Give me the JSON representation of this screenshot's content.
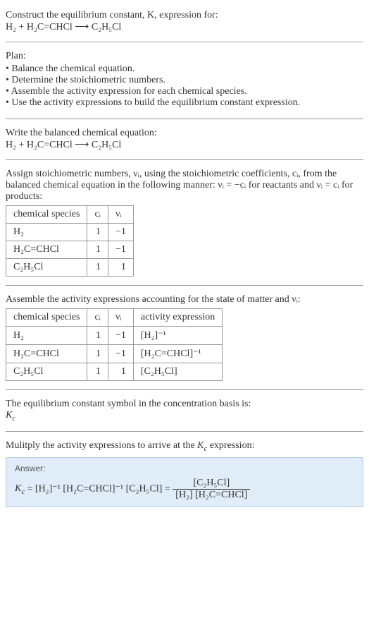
{
  "intro": {
    "line1": "Construct the equilibrium constant, K, expression for:",
    "equation": "H₂ + H₂C=CHCl ⟶ C₂H₅Cl"
  },
  "plan": {
    "heading": "Plan:",
    "items": [
      "Balance the chemical equation.",
      "Determine the stoichiometric numbers.",
      "Assemble the activity expression for each chemical species.",
      "Use the activity expressions to build the equilibrium constant expression."
    ]
  },
  "balanced": {
    "heading": "Write the balanced chemical equation:",
    "equation": "H₂ + H₂C=CHCl ⟶ C₂H₅Cl"
  },
  "stoich": {
    "text": "Assign stoichiometric numbers, νᵢ, using the stoichiometric coefficients, cᵢ, from the balanced chemical equation in the following manner: νᵢ = −cᵢ for reactants and νᵢ = cᵢ for products:",
    "headers": {
      "species": "chemical species",
      "ci": "cᵢ",
      "vi": "νᵢ"
    },
    "rows": [
      {
        "species": "H₂",
        "ci": "1",
        "vi": "−1"
      },
      {
        "species": "H₂C=CHCl",
        "ci": "1",
        "vi": "−1"
      },
      {
        "species": "C₂H₅Cl",
        "ci": "1",
        "vi": "1"
      }
    ]
  },
  "activity": {
    "text": "Assemble the activity expressions accounting for the state of matter and νᵢ:",
    "headers": {
      "species": "chemical species",
      "ci": "cᵢ",
      "vi": "νᵢ",
      "expr": "activity expression"
    },
    "rows": [
      {
        "species": "H₂",
        "ci": "1",
        "vi": "−1",
        "expr": "[H₂]⁻¹"
      },
      {
        "species": "H₂C=CHCl",
        "ci": "1",
        "vi": "−1",
        "expr": "[H₂C=CHCl]⁻¹"
      },
      {
        "species": "C₂H₅Cl",
        "ci": "1",
        "vi": "1",
        "expr": "[C₂H₅Cl]"
      }
    ]
  },
  "symbol": {
    "text": "The equilibrium constant symbol in the concentration basis is:",
    "sym": "K_c"
  },
  "final": {
    "text": "Mulitply the activity expressions to arrive at the K_c expression:",
    "answer_label": "Answer:",
    "kc_eq_left": "K_c = [H₂]⁻¹ [H₂C=CHCl]⁻¹ [C₂H₅Cl] =",
    "frac_num": "[C₂H₅Cl]",
    "frac_den": "[H₂] [H₂C=CHCl]"
  },
  "chart_data": {
    "type": "table",
    "tables": [
      {
        "title": "stoichiometric numbers",
        "columns": [
          "chemical species",
          "cᵢ",
          "νᵢ"
        ],
        "rows": [
          [
            "H₂",
            1,
            -1
          ],
          [
            "H₂C=CHCl",
            1,
            -1
          ],
          [
            "C₂H₅Cl",
            1,
            1
          ]
        ]
      },
      {
        "title": "activity expressions",
        "columns": [
          "chemical species",
          "cᵢ",
          "νᵢ",
          "activity expression"
        ],
        "rows": [
          [
            "H₂",
            1,
            -1,
            "[H₂]⁻¹"
          ],
          [
            "H₂C=CHCl",
            1,
            -1,
            "[H₂C=CHCl]⁻¹"
          ],
          [
            "C₂H₅Cl",
            1,
            1,
            "[C₂H₅Cl]"
          ]
        ]
      }
    ]
  }
}
